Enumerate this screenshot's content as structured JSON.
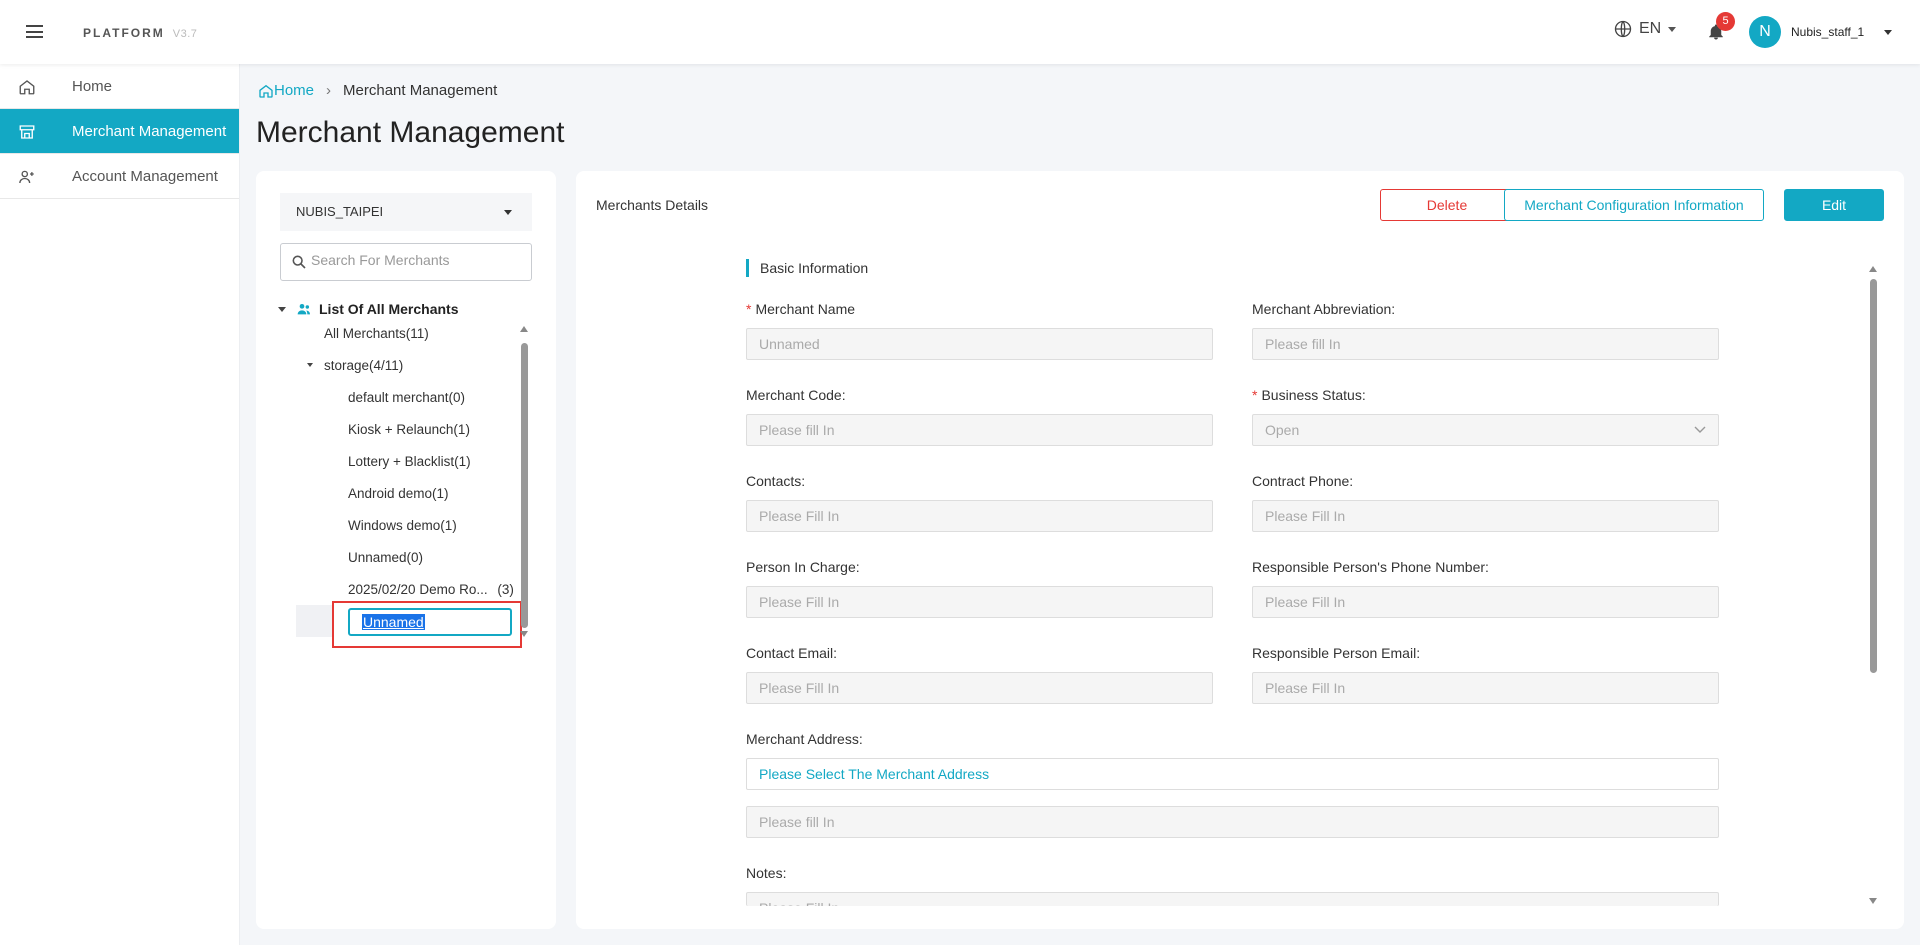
{
  "header": {
    "brand": "PLATFORM",
    "version": "V3.7",
    "language": "EN",
    "notification_count": "5",
    "avatar_initial": "N",
    "username": "Nubis_staff_1"
  },
  "sidebar": {
    "items": [
      {
        "label": "Home",
        "icon": "home-icon"
      },
      {
        "label": "Merchant Management",
        "icon": "store-icon",
        "active": true
      },
      {
        "label": "Account Management",
        "icon": "users-icon"
      }
    ]
  },
  "breadcrumb": {
    "home": "Home",
    "current": "Merchant Management"
  },
  "page_title": "Merchant Management",
  "tree": {
    "org_select": "NUBIS_TAIPEI",
    "search_placeholder": "Search For Merchants",
    "root_label": "List Of All Merchants",
    "all_merchants": "All Merchants(11)",
    "group_label": "storage(4/11)",
    "items": [
      "default merchant(0)",
      "Kiosk + Relaunch(1)",
      "Lottery + Blacklist(1)",
      "Android demo(1)",
      "Windows demo(1)",
      "Unnamed(0)",
      "2025/02/20 Demo Ro..."
    ],
    "last_item_count": "(3)",
    "editing_value": "Unnamed"
  },
  "details": {
    "title": "Merchants Details",
    "delete_label": "Delete",
    "config_label": "Merchant Configuration Information",
    "edit_label": "Edit",
    "section_title": "Basic Information",
    "fields": {
      "merchant_name": {
        "label": "Merchant Name",
        "value": "Unnamed"
      },
      "merchant_abbreviation": {
        "label": "Merchant Abbreviation:",
        "placeholder": "Please fill In"
      },
      "merchant_code": {
        "label": "Merchant Code:",
        "placeholder": "Please fill In"
      },
      "business_status": {
        "label": "Business Status:",
        "value": "Open"
      },
      "contacts": {
        "label": "Contacts:",
        "placeholder": "Please Fill In"
      },
      "contract_phone": {
        "label": "Contract Phone:",
        "placeholder": "Please Fill In"
      },
      "person_in_charge": {
        "label": "Person In Charge:",
        "placeholder": "Please Fill In"
      },
      "responsible_phone": {
        "label": "Responsible Person's Phone Number:",
        "placeholder": "Please Fill In"
      },
      "contact_email": {
        "label": "Contact Email:",
        "placeholder": "Please Fill In"
      },
      "responsible_email": {
        "label": "Responsible Person Email:",
        "placeholder": "Please Fill In"
      },
      "merchant_address": {
        "label": "Merchant Address:",
        "select_text": "Please Select The Merchant Address",
        "detail_placeholder": "Please fill In"
      },
      "notes": {
        "label": "Notes:",
        "placeholder": "Please Fill In"
      }
    }
  },
  "colors": {
    "accent": "#13a8c4",
    "danger": "#e53935"
  }
}
